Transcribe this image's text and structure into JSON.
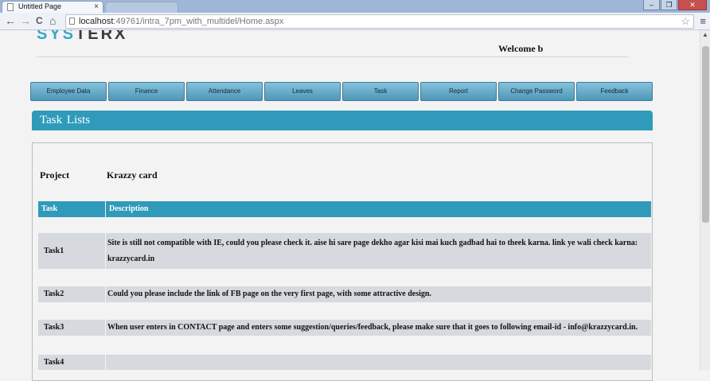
{
  "browser": {
    "tab_title": "Untitled Page",
    "tab_close": "×",
    "tab2_title": "",
    "nav": {
      "back": "←",
      "forward": "→",
      "reload": "C",
      "home": "⌂"
    },
    "url_host": "localhost",
    "url_rest": ":49761/intra_7pm_with_multidel/Home.aspx",
    "star": "☆",
    "menu": "≡",
    "window_buttons": {
      "minimize": "–",
      "restore": "❐",
      "close": "✕"
    }
  },
  "header": {
    "logo_part1": "SYS",
    "logo_part2": "TER",
    "logo_part3": "X",
    "welcome": "Welcome b"
  },
  "menu": [
    {
      "label": "Employee  Data"
    },
    {
      "label": "Finance"
    },
    {
      "label": "Attendance"
    },
    {
      "label": "Leaves"
    },
    {
      "label": "Task"
    },
    {
      "label": "Report"
    },
    {
      "label": "Change Password"
    },
    {
      "label": "Feedback"
    }
  ],
  "panel": {
    "title": "Task  Lists"
  },
  "project": {
    "label": "Project",
    "name": "Krazzy card"
  },
  "table": {
    "headers": [
      "Task",
      "Description"
    ],
    "rows": [
      {
        "task": "Task1",
        "description": "Site is still not compatible with IE, could you please check it. aise hi sare page dekho agar kisi mai kuch gadbad hai to theek karna. link ye wali check karna: krazzycard.in"
      },
      {
        "task": "Task2",
        "description": "Could you please include the link of FB page on the very first page, with some attractive design."
      },
      {
        "task": "Task3",
        "description": "When user enters in CONTACT page and enters some suggestion/queries/feedback, please make sure that it goes to following email-id - info@krazzycard.in."
      },
      {
        "task": "Task4",
        "description": ""
      }
    ]
  },
  "colors": {
    "accent": "#2f9ab9",
    "row_bg": "#d6d9dd",
    "button": "#5ea8c8"
  }
}
